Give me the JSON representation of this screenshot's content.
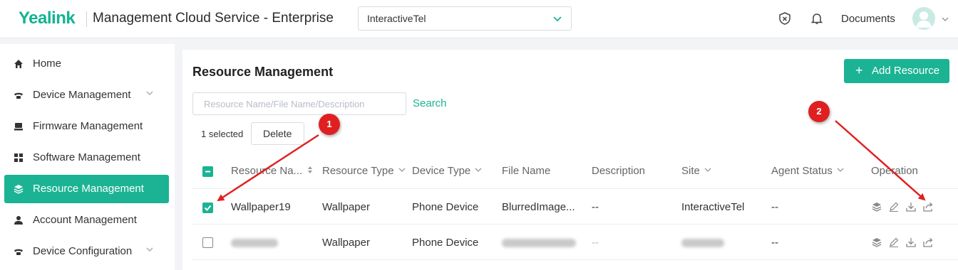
{
  "header": {
    "logo": "Yealink",
    "app_title": "Management Cloud Service - Enterprise",
    "tenant": "InteractiveTel",
    "documents": "Documents"
  },
  "sidebar": {
    "items": [
      {
        "label": "Home",
        "icon": "home-icon",
        "expandable": false,
        "active": false
      },
      {
        "label": "Device Management",
        "icon": "phone-icon",
        "expandable": true,
        "active": false
      },
      {
        "label": "Firmware Management",
        "icon": "firmware-icon",
        "expandable": false,
        "active": false
      },
      {
        "label": "Software Management",
        "icon": "software-icon",
        "expandable": false,
        "active": false
      },
      {
        "label": "Resource Management",
        "icon": "layers-icon",
        "expandable": false,
        "active": true
      },
      {
        "label": "Account Management",
        "icon": "user-icon",
        "expandable": false,
        "active": false
      },
      {
        "label": "Device Configuration",
        "icon": "phone-icon",
        "expandable": true,
        "active": false
      }
    ]
  },
  "main": {
    "title": "Resource Management",
    "add_button": "Add Resource",
    "search_placeholder": "Resource Name/File Name/Description",
    "search_label": "Search",
    "selected_text": "1 selected",
    "delete_button": "Delete"
  },
  "table": {
    "columns": [
      "Resource Na...",
      "Resource Type",
      "Device Type",
      "File Name",
      "Description",
      "Site",
      "Agent Status",
      "Operation"
    ],
    "rows": [
      {
        "checked": true,
        "name": "Wallpaper19",
        "type": "Wallpaper",
        "device": "Phone Device",
        "file": "BlurredImage...",
        "description": "--",
        "site": "InteractiveTel",
        "agent": "--"
      },
      {
        "checked": false,
        "name": "",
        "type": "Wallpaper",
        "device": "Phone Device",
        "file": "",
        "description": "--",
        "site": "",
        "agent": "--"
      }
    ]
  },
  "annotations": {
    "marker_1": "1",
    "marker_2": "2"
  },
  "colors": {
    "accent": "#1bb394",
    "annotation": "#e02020"
  }
}
